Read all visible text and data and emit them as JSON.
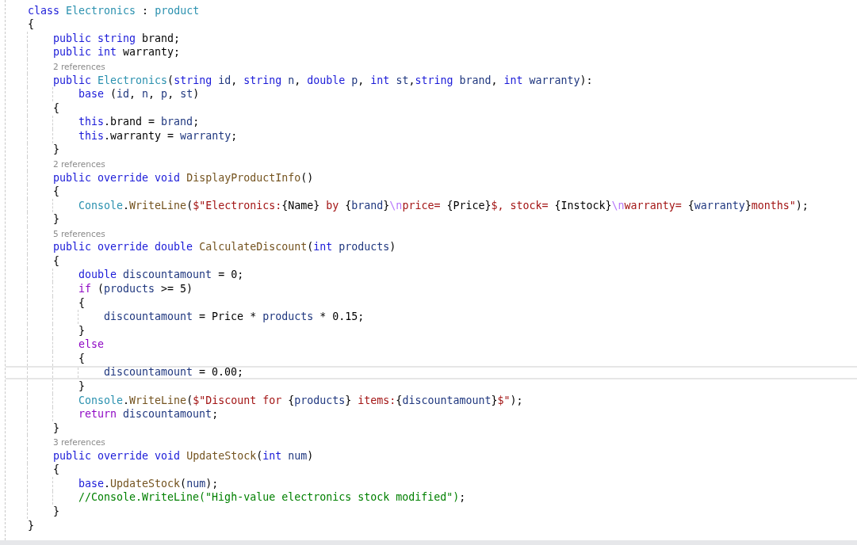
{
  "editor": {
    "lines": [
      {
        "kind": "code",
        "current": false,
        "tokens": [
          {
            "t": "class ",
            "kind": "kw"
          },
          {
            "t": "Electronics",
            "kind": "ty"
          },
          {
            "t": " : ",
            "kind": "pl"
          },
          {
            "t": "product",
            "kind": "ty"
          }
        ]
      },
      {
        "kind": "code",
        "current": false,
        "tokens": [
          {
            "t": "{",
            "kind": "pl"
          }
        ],
        "children": [
          {
            "kind": "code",
            "current": false,
            "tokens": [
              {
                "t": "public string ",
                "kind": "kw"
              },
              {
                "t": "brand;",
                "kind": "pl"
              }
            ]
          },
          {
            "kind": "code",
            "current": false,
            "tokens": [
              {
                "t": "public int ",
                "kind": "kw"
              },
              {
                "t": "warranty;",
                "kind": "pl"
              }
            ]
          },
          {
            "kind": "refs",
            "current": false,
            "text": "2 references"
          },
          {
            "kind": "code",
            "current": false,
            "tokens": [
              {
                "t": "public ",
                "kind": "kw"
              },
              {
                "t": "Electronics",
                "kind": "ty"
              },
              {
                "t": "(",
                "kind": "pl"
              },
              {
                "t": "string ",
                "kind": "kw"
              },
              {
                "t": "id",
                "kind": "pa"
              },
              {
                "t": ", ",
                "kind": "pl"
              },
              {
                "t": "string ",
                "kind": "kw"
              },
              {
                "t": "n",
                "kind": "pa"
              },
              {
                "t": ", ",
                "kind": "pl"
              },
              {
                "t": "double ",
                "kind": "kw"
              },
              {
                "t": "p",
                "kind": "pa"
              },
              {
                "t": ", ",
                "kind": "pl"
              },
              {
                "t": "int ",
                "kind": "kw"
              },
              {
                "t": "st",
                "kind": "pa"
              },
              {
                "t": ",",
                "kind": "pl"
              },
              {
                "t": "string ",
                "kind": "kw"
              },
              {
                "t": "brand",
                "kind": "pa"
              },
              {
                "t": ", ",
                "kind": "pl"
              },
              {
                "t": "int ",
                "kind": "kw"
              },
              {
                "t": "warranty",
                "kind": "pa"
              },
              {
                "t": "):",
                "kind": "pl"
              }
            ],
            "children": [
              {
                "kind": "code",
                "current": false,
                "tokens": [
                  {
                    "t": "base ",
                    "kind": "kw"
                  },
                  {
                    "t": "(",
                    "kind": "pl"
                  },
                  {
                    "t": "id",
                    "kind": "pa"
                  },
                  {
                    "t": ", ",
                    "kind": "pl"
                  },
                  {
                    "t": "n",
                    "kind": "pa"
                  },
                  {
                    "t": ", ",
                    "kind": "pl"
                  },
                  {
                    "t": "p",
                    "kind": "pa"
                  },
                  {
                    "t": ", ",
                    "kind": "pl"
                  },
                  {
                    "t": "st",
                    "kind": "pa"
                  },
                  {
                    "t": ")",
                    "kind": "pl"
                  }
                ]
              }
            ]
          },
          {
            "kind": "code",
            "current": false,
            "tokens": [
              {
                "t": "{",
                "kind": "pl"
              }
            ],
            "children": [
              {
                "kind": "code",
                "current": false,
                "tokens": [
                  {
                    "t": "this",
                    "kind": "kw"
                  },
                  {
                    "t": ".brand = ",
                    "kind": "pl"
                  },
                  {
                    "t": "brand",
                    "kind": "pa"
                  },
                  {
                    "t": ";",
                    "kind": "pl"
                  }
                ]
              },
              {
                "kind": "code",
                "current": false,
                "tokens": [
                  {
                    "t": "this",
                    "kind": "kw"
                  },
                  {
                    "t": ".warranty = ",
                    "kind": "pl"
                  },
                  {
                    "t": "warranty",
                    "kind": "pa"
                  },
                  {
                    "t": ";",
                    "kind": "pl"
                  }
                ]
              }
            ]
          },
          {
            "kind": "code",
            "current": false,
            "tokens": [
              {
                "t": "}",
                "kind": "pl"
              }
            ]
          },
          {
            "kind": "refs",
            "current": false,
            "text": "2 references"
          },
          {
            "kind": "code",
            "current": false,
            "tokens": [
              {
                "t": "public override void ",
                "kind": "kw"
              },
              {
                "t": "DisplayProductInfo",
                "kind": "me"
              },
              {
                "t": "()",
                "kind": "pl"
              }
            ]
          },
          {
            "kind": "code",
            "current": false,
            "tokens": [
              {
                "t": "{",
                "kind": "pl"
              }
            ],
            "children": [
              {
                "kind": "code",
                "current": false,
                "tokens": [
                  {
                    "t": "Console",
                    "kind": "ty"
                  },
                  {
                    "t": ".",
                    "kind": "pl"
                  },
                  {
                    "t": "WriteLine",
                    "kind": "me"
                  },
                  {
                    "t": "(",
                    "kind": "pl"
                  },
                  {
                    "t": "$\"Electronics:",
                    "kind": "st"
                  },
                  {
                    "t": "{Name}",
                    "kind": "pl"
                  },
                  {
                    "t": " by ",
                    "kind": "st"
                  },
                  {
                    "t": "{",
                    "kind": "pl"
                  },
                  {
                    "t": "brand",
                    "kind": "pa"
                  },
                  {
                    "t": "}",
                    "kind": "pl"
                  },
                  {
                    "t": "\\n",
                    "kind": "es"
                  },
                  {
                    "t": "price= ",
                    "kind": "st"
                  },
                  {
                    "t": "{Price}",
                    "kind": "pl"
                  },
                  {
                    "t": "$, stock= ",
                    "kind": "st"
                  },
                  {
                    "t": "{Instock}",
                    "kind": "pl"
                  },
                  {
                    "t": "\\n",
                    "kind": "es"
                  },
                  {
                    "t": "warranty= ",
                    "kind": "st"
                  },
                  {
                    "t": "{",
                    "kind": "pl"
                  },
                  {
                    "t": "warranty",
                    "kind": "pa"
                  },
                  {
                    "t": "}",
                    "kind": "pl"
                  },
                  {
                    "t": "months\"",
                    "kind": "st"
                  },
                  {
                    "t": ");",
                    "kind": "pl"
                  }
                ]
              }
            ]
          },
          {
            "kind": "code",
            "current": false,
            "tokens": [
              {
                "t": "}",
                "kind": "pl"
              }
            ]
          },
          {
            "kind": "refs",
            "current": false,
            "text": "5 references"
          },
          {
            "kind": "code",
            "current": false,
            "tokens": [
              {
                "t": "public override double ",
                "kind": "kw"
              },
              {
                "t": "CalculateDiscount",
                "kind": "me"
              },
              {
                "t": "(",
                "kind": "pl"
              },
              {
                "t": "int ",
                "kind": "kw"
              },
              {
                "t": "products",
                "kind": "pa"
              },
              {
                "t": ")",
                "kind": "pl"
              }
            ]
          },
          {
            "kind": "code",
            "current": false,
            "tokens": [
              {
                "t": "{",
                "kind": "pl"
              }
            ],
            "children": [
              {
                "kind": "code",
                "current": false,
                "tokens": [
                  {
                    "t": "double ",
                    "kind": "kw"
                  },
                  {
                    "t": "discountamount",
                    "kind": "pa"
                  },
                  {
                    "t": " = 0;",
                    "kind": "pl"
                  }
                ]
              },
              {
                "kind": "code",
                "current": false,
                "tokens": [
                  {
                    "t": "if ",
                    "kind": "ct"
                  },
                  {
                    "t": "(",
                    "kind": "pl"
                  },
                  {
                    "t": "products",
                    "kind": "pa"
                  },
                  {
                    "t": " >= 5)",
                    "kind": "pl"
                  }
                ]
              },
              {
                "kind": "code",
                "current": false,
                "tokens": [
                  {
                    "t": "{",
                    "kind": "pl"
                  }
                ],
                "children": [
                  {
                    "kind": "code",
                    "current": false,
                    "tokens": [
                      {
                        "t": "discountamount",
                        "kind": "pa"
                      },
                      {
                        "t": " = Price * ",
                        "kind": "pl"
                      },
                      {
                        "t": "products",
                        "kind": "pa"
                      },
                      {
                        "t": " * 0.15;",
                        "kind": "pl"
                      }
                    ]
                  }
                ]
              },
              {
                "kind": "code",
                "current": false,
                "tokens": [
                  {
                    "t": "}",
                    "kind": "pl"
                  }
                ]
              },
              {
                "kind": "code",
                "current": false,
                "tokens": [
                  {
                    "t": "else",
                    "kind": "ct"
                  }
                ]
              },
              {
                "kind": "code",
                "current": false,
                "tokens": [
                  {
                    "t": "{",
                    "kind": "pl"
                  }
                ],
                "children": [
                  {
                    "kind": "code",
                    "current": true,
                    "tokens": [
                      {
                        "t": "discountamount",
                        "kind": "pa"
                      },
                      {
                        "t": " = 0.00;",
                        "kind": "pl"
                      }
                    ]
                  }
                ]
              },
              {
                "kind": "code",
                "current": false,
                "tokens": [
                  {
                    "t": "}",
                    "kind": "pl"
                  }
                ]
              },
              {
                "kind": "code",
                "current": false,
                "tokens": [
                  {
                    "t": "Console",
                    "kind": "ty"
                  },
                  {
                    "t": ".",
                    "kind": "pl"
                  },
                  {
                    "t": "WriteLine",
                    "kind": "me"
                  },
                  {
                    "t": "(",
                    "kind": "pl"
                  },
                  {
                    "t": "$\"Discount for ",
                    "kind": "st"
                  },
                  {
                    "t": "{",
                    "kind": "pl"
                  },
                  {
                    "t": "products",
                    "kind": "pa"
                  },
                  {
                    "t": "}",
                    "kind": "pl"
                  },
                  {
                    "t": " items:",
                    "kind": "st"
                  },
                  {
                    "t": "{",
                    "kind": "pl"
                  },
                  {
                    "t": "discountamount",
                    "kind": "pa"
                  },
                  {
                    "t": "}",
                    "kind": "pl"
                  },
                  {
                    "t": "$\"",
                    "kind": "st"
                  },
                  {
                    "t": ");",
                    "kind": "pl"
                  }
                ]
              },
              {
                "kind": "code",
                "current": false,
                "tokens": [
                  {
                    "t": "return ",
                    "kind": "ct"
                  },
                  {
                    "t": "discountamount",
                    "kind": "pa"
                  },
                  {
                    "t": ";",
                    "kind": "pl"
                  }
                ]
              }
            ]
          },
          {
            "kind": "code",
            "current": false,
            "tokens": [
              {
                "t": "}",
                "kind": "pl"
              }
            ]
          },
          {
            "kind": "refs",
            "current": false,
            "text": "3 references"
          },
          {
            "kind": "code",
            "current": false,
            "tokens": [
              {
                "t": "public override void ",
                "kind": "kw"
              },
              {
                "t": "UpdateStock",
                "kind": "me"
              },
              {
                "t": "(",
                "kind": "pl"
              },
              {
                "t": "int ",
                "kind": "kw"
              },
              {
                "t": "num",
                "kind": "pa"
              },
              {
                "t": ")",
                "kind": "pl"
              }
            ]
          },
          {
            "kind": "code",
            "current": false,
            "tokens": [
              {
                "t": "{",
                "kind": "pl"
              }
            ],
            "children": [
              {
                "kind": "code",
                "current": false,
                "tokens": [
                  {
                    "t": "base",
                    "kind": "kw"
                  },
                  {
                    "t": ".",
                    "kind": "pl"
                  },
                  {
                    "t": "UpdateStock",
                    "kind": "me"
                  },
                  {
                    "t": "(",
                    "kind": "pl"
                  },
                  {
                    "t": "num",
                    "kind": "pa"
                  },
                  {
                    "t": ");",
                    "kind": "pl"
                  }
                ]
              },
              {
                "kind": "code",
                "current": false,
                "tokens": [
                  {
                    "t": "//Console.WriteLine(\"High-value electronics stock modified\")",
                    "kind": "cm"
                  },
                  {
                    "t": ";",
                    "kind": "pl"
                  }
                ]
              }
            ]
          },
          {
            "kind": "code",
            "current": false,
            "tokens": [
              {
                "t": "}",
                "kind": "pl"
              }
            ]
          }
        ]
      },
      {
        "kind": "code",
        "current": false,
        "tokens": [
          {
            "t": "}",
            "kind": "pl"
          }
        ]
      }
    ]
  }
}
